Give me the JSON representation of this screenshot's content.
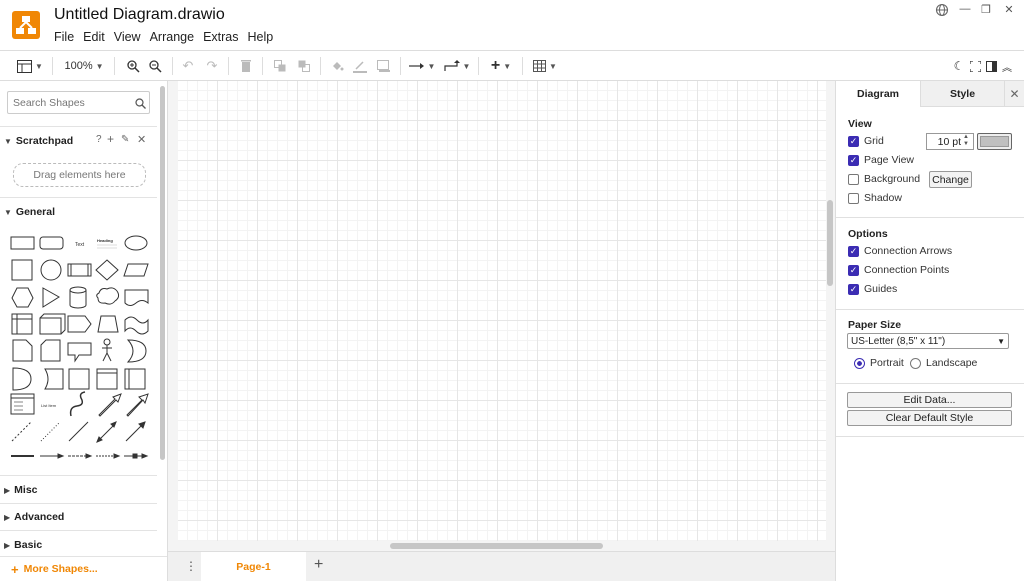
{
  "window": {
    "title": "Untitled Diagram.drawio",
    "menu": [
      "File",
      "Edit",
      "View",
      "Arrange",
      "Extras",
      "Help"
    ],
    "controls": [
      "globe-icon",
      "minimize-icon",
      "restore-icon",
      "close-icon"
    ]
  },
  "toolbar": {
    "zoom": "100%",
    "icons": [
      "sidebar-toggle-icon",
      "zoom-in-icon",
      "zoom-out-icon",
      "undo-icon",
      "redo-icon",
      "delete-icon",
      "to-front-icon",
      "to-back-icon",
      "fill-color-icon",
      "line-color-icon",
      "shadow-icon",
      "connection-icon",
      "waypoints-icon",
      "insert-icon",
      "table-icon",
      "dark-mode-icon",
      "fullscreen-icon",
      "format-panel-icon",
      "collapse-icon"
    ]
  },
  "sidebar": {
    "search_placeholder": "Search Shapes",
    "scratchpad": {
      "title": "Scratchpad",
      "drop_hint": "Drag elements here"
    },
    "general": {
      "title": "General",
      "text_shape": "Text",
      "heading_shape": "Heading",
      "list_item": "List Item"
    },
    "sections": [
      "Misc",
      "Advanced",
      "Basic"
    ],
    "more_shapes": "More Shapes..."
  },
  "pages": {
    "active": "Page-1"
  },
  "format_panel": {
    "tabs": [
      "Diagram",
      "Style"
    ],
    "view": {
      "title": "View",
      "grid": {
        "label": "Grid",
        "checked": true,
        "size": "10 pt",
        "color": "#c0c0c0"
      },
      "page_view": {
        "label": "Page View",
        "checked": true
      },
      "background": {
        "label": "Background",
        "checked": false,
        "button": "Change"
      },
      "shadow": {
        "label": "Shadow",
        "checked": false
      }
    },
    "options": {
      "title": "Options",
      "items": [
        {
          "label": "Connection Arrows",
          "checked": true
        },
        {
          "label": "Connection Points",
          "checked": true
        },
        {
          "label": "Guides",
          "checked": true
        }
      ]
    },
    "paper": {
      "title": "Paper Size",
      "size": "US-Letter (8,5\" x 11\")",
      "orientation": [
        "Portrait",
        "Landscape"
      ],
      "selected": "Portrait"
    },
    "buttons": {
      "edit_data": "Edit Data...",
      "clear_style": "Clear Default Style"
    }
  },
  "colors": {
    "accent": "#f08705",
    "checkbox": "#3b2cb3"
  }
}
